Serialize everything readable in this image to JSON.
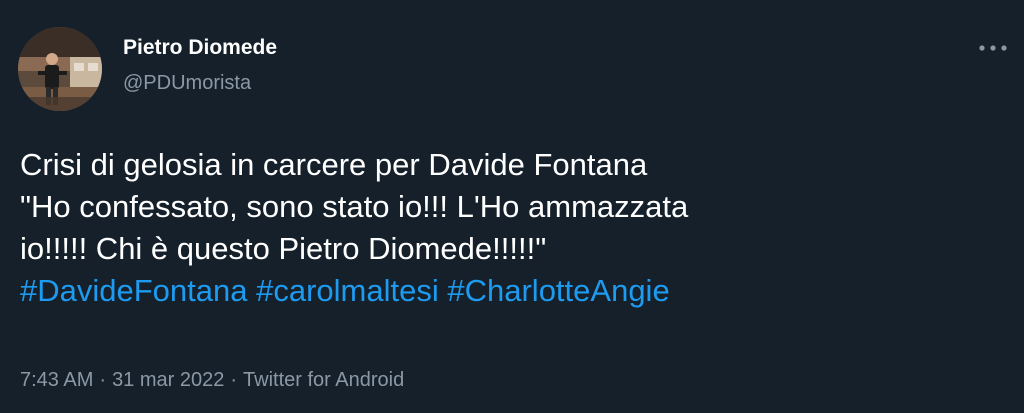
{
  "author": {
    "display_name": "Pietro Diomede",
    "handle": "@PDUmorista"
  },
  "tweet": {
    "lines": [
      "Crisi di gelosia in carcere per Davide Fontana",
      "\"Ho confessato, sono stato io!!! L'Ho ammazzata",
      "io!!!!! Chi è questo Pietro Diomede!!!!!\""
    ],
    "hashtags": [
      "#DavideFontana",
      "#carolmaltesi",
      "#CharlotteAngie"
    ]
  },
  "meta": {
    "time": "7:43 AM",
    "separator": "·",
    "date": "31 mar 2022",
    "source": "Twitter for Android"
  },
  "icons": {
    "more": "more-horizontal-icon"
  },
  "colors": {
    "background": "#15202b",
    "text": "#ffffff",
    "secondary": "#8b98a5",
    "link": "#1d9bf0"
  }
}
